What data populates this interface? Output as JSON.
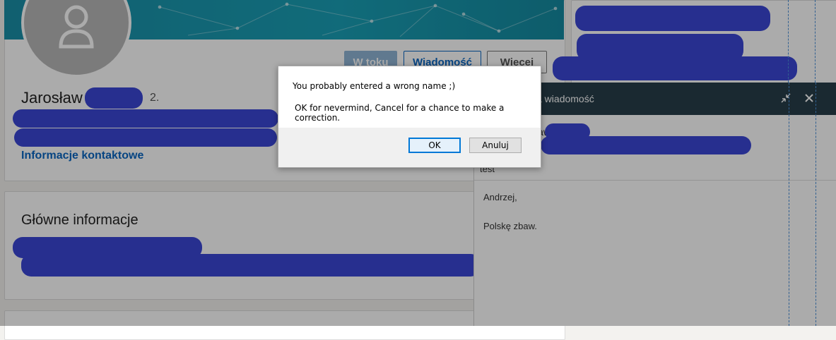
{
  "profile": {
    "first_name": "Jarosław",
    "degree": "2.",
    "contact_link": "Informacje kontaktowe",
    "btn_pending": "W toku",
    "btn_message": "Wiadomość",
    "btn_more": "Więcej"
  },
  "main_info": {
    "title": "Główne informacje"
  },
  "message_panel": {
    "header_title": "Nowa wiadomość",
    "header_title_visible": "mość",
    "recipient_label": "law",
    "subject": "test",
    "body_line1": "Andrzej,",
    "body_line2": "Polskę zbaw."
  },
  "dialog": {
    "line1": "You probably entered a wrong name ;)",
    "line2": "OK for nevermind, Cancel for a chance to make a correction.",
    "ok_label": "OK",
    "cancel_label": "Anuluj"
  },
  "colors": {
    "accent": "#0a66c2",
    "redaction": "#3b46d6",
    "message_header": "#283e4a",
    "banner": "#1a9ab0"
  }
}
